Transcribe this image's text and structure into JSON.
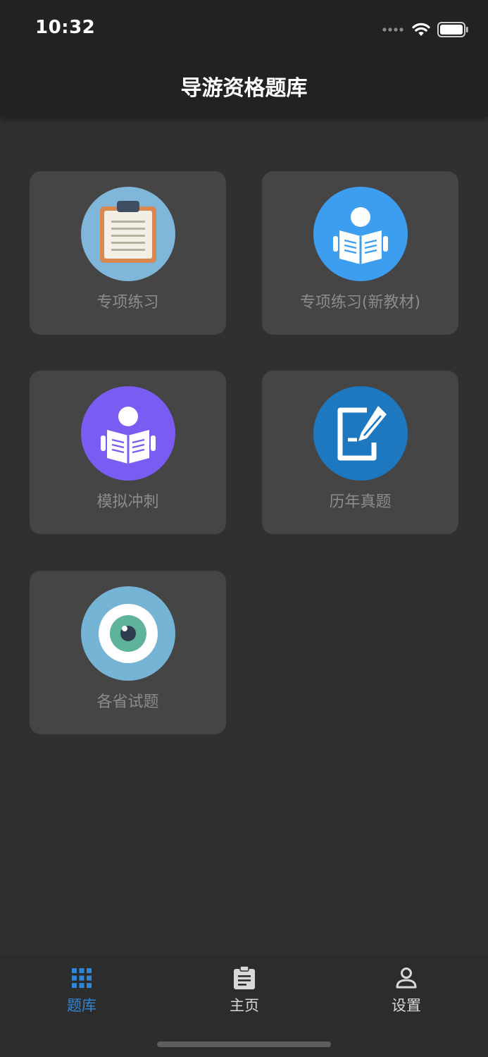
{
  "status_bar": {
    "time": "10:32",
    "icons": [
      "signal-dots-icon",
      "wifi-icon",
      "battery-icon"
    ]
  },
  "header": {
    "title": "导游资格题库"
  },
  "cards": [
    {
      "label": "专项练习",
      "icon": "clipboard-icon",
      "color": "#7fb6d9"
    },
    {
      "label": "专项练习(新教材)",
      "icon": "reading-person-icon",
      "color": "#3d9ef0"
    },
    {
      "label": "模拟冲刺",
      "icon": "reading-person-icon",
      "color": "#7b5cf2"
    },
    {
      "label": "历年真题",
      "icon": "pen-paper-icon",
      "color": "#1e78c0"
    },
    {
      "label": "各省试题",
      "icon": "eye-icon",
      "color": "#76b4d6"
    }
  ],
  "tabbar": {
    "tabs": [
      {
        "label": "题库",
        "icon": "grid-icon",
        "active": true
      },
      {
        "label": "主页",
        "icon": "clipboard-doc-icon",
        "active": false
      },
      {
        "label": "设置",
        "icon": "person-icon",
        "active": false
      }
    ],
    "active_color": "#2f86d8",
    "inactive_color": "#d8d8d8"
  },
  "colors": {
    "background": "#303030",
    "header": "#222222",
    "card": "#454545",
    "card_label": "#8c8c8c"
  }
}
